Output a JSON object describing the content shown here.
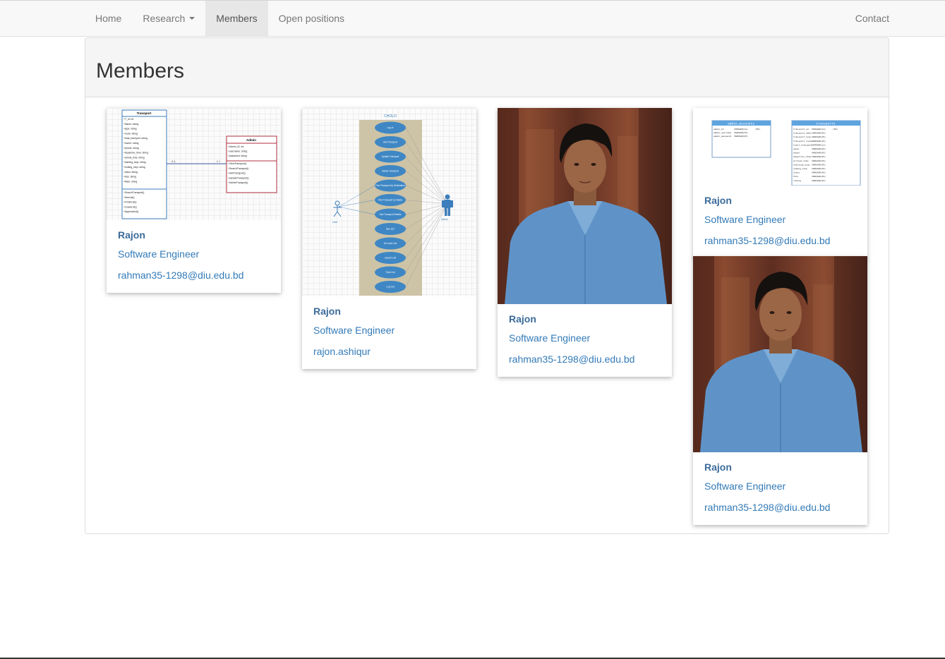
{
  "nav": {
    "left": [
      {
        "label": "Home"
      },
      {
        "label": "Research"
      },
      {
        "label": "Members"
      },
      {
        "label": "Open positions"
      }
    ],
    "right": [
      {
        "label": "Contact"
      }
    ]
  },
  "page": {
    "title": "Members"
  },
  "members": [
    {
      "name": "Rajon",
      "role": "Software Engineer",
      "email": "rahman35-1298@diu.edu.bd"
    },
    {
      "name": "Rajon",
      "role": "Software Engineer",
      "email": "rajon.ashiqur"
    },
    {
      "name": "Rajon",
      "role": "Software Engineer",
      "email": "rahman35-1298@diu.edu.bd"
    },
    {
      "name": "Rajon",
      "role": "Software Engineer",
      "email": "rahman35-1298@diu.edu.bd"
    },
    {
      "name": "Rajon",
      "role": "Software Engineer",
      "email": "rahman35-1298@diu.edu.bd"
    }
  ],
  "diagrams": {
    "class_diagram": {
      "left_box_title": "Transport",
      "left_box_attrs": [
        "+T_id: int",
        "+Name: string",
        "+type: string",
        "+route: string",
        "+total_transport: string",
        "+owner: string",
        "+phone: string",
        "+departure_time: string",
        "+arrival_time: string",
        "+starting_stop: string",
        "+ending_stop: string",
        "+class: string",
        "+fare: string",
        "+Rate: string"
      ],
      "left_box_methods": [
        "+SearchTransport()",
        "+SeeList()",
        "+FinishList()",
        "+LeaveList()",
        "+AppendList()"
      ],
      "right_box_title": "Admin",
      "right_box_attrs": [
        "+Admin_ID: int",
        "+username: string",
        "+password: string"
      ],
      "right_box_methods": [
        "+ViewTransport()",
        "+SearchTransport()",
        "+AddTransport()",
        "+UpdateTransport()",
        "+DeleteTransport()"
      ],
      "mult_left": "0..1",
      "mult_right": "1..*"
    },
    "use_case": {
      "title": "CHOLO",
      "actor_left": "User",
      "actor_right": "Admin",
      "cases": [
        "Log In",
        "Add Transport",
        "Update Transport",
        "Delete Transport",
        "Find Transport by Destination",
        "Find Transport by Name",
        "See Transport Details",
        "Bus List",
        "Air Lines List",
        "Launch List",
        "Train List",
        "Log Out"
      ]
    },
    "erd": {
      "left_table": "admin_accounts",
      "left_rows": [
        [
          "admin_id",
          "INTEGER(11)",
          "(PK)"
        ],
        [
          "admin_username",
          "VARCHAR(45)",
          ""
        ],
        [
          "admin_password",
          "VARCHAR(45)",
          ""
        ]
      ],
      "right_table": "transports",
      "right_rows": [
        [
          "transport_id",
          "INTEGER(11)",
          "(PK)"
        ],
        [
          "transport_name",
          "VARCHAR(45)",
          ""
        ],
        [
          "transport_type",
          "VARCHAR(45)",
          ""
        ],
        [
          "transport_route",
          "VARCHAR(45)",
          ""
        ],
        [
          "total_transport",
          "INTEGER(11)",
          ""
        ],
        [
          "owner",
          "VARCHAR(45)",
          ""
        ],
        [
          "phone",
          "VARCHAR(45)",
          ""
        ],
        [
          "departure_time",
          "VARCHAR(45)",
          ""
        ],
        [
          "arrival_time",
          "VARCHAR(45)",
          ""
        ],
        [
          "starting_stop",
          "VARCHAR(45)",
          ""
        ],
        [
          "ending_stop",
          "VARCHAR(45)",
          ""
        ],
        [
          "class",
          "VARCHAR(45)",
          ""
        ],
        [
          "fare",
          "VARCHAR(45)",
          ""
        ],
        [
          "rating",
          "VARCHAR(45)",
          ""
        ]
      ]
    }
  },
  "colors": {
    "navbar_bg": "#f8f8f8",
    "link": "#337ab7",
    "name": "#3b6b9a",
    "panel_heading_bg": "#f5f5f5",
    "shirt": "#5f93c8",
    "wall": "#6b3424"
  }
}
